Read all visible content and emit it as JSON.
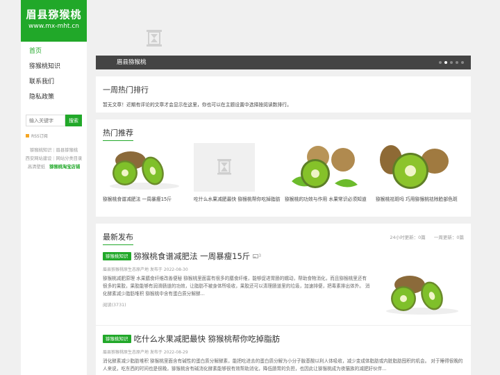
{
  "site": {
    "title": "眉县猕猴桃",
    "url": "www.mx-mht.cn"
  },
  "nav": [
    {
      "label": "首页",
      "active": true
    },
    {
      "label": "猕猴桃知识",
      "active": false
    },
    {
      "label": "联系我们",
      "active": false
    },
    {
      "label": "隐私政策",
      "active": false
    }
  ],
  "search": {
    "placeholder": "输入关键字",
    "button": "搜索"
  },
  "rss": "RSS订阅",
  "links": [
    "猕猴桃知识",
    "眉县猕猴桃",
    "西安网站建设",
    "网站分类目录",
    "高清壁纸",
    "猕猴桃淘宝店铺"
  ],
  "banner": {
    "caption": "眉县猕猴桃"
  },
  "hot_week": {
    "title": "一周热门排行",
    "note": "暂无文章！近期有评论的文章才会显示在这里，你也可以在主题设置中选择按阅读数排行。"
  },
  "recommend": {
    "title": "热门推荐",
    "items": [
      "猕猴桃食谱减肥法 一周暴瘦15斤",
      "吃什么水果减肥最快 猕猴桃帮你吃掉脂肪",
      "猕猴桃的功效与作用 水果常识必须知道",
      "猕猴桃祛斑吗 巧用猕猴桃祛除脸部色斑"
    ]
  },
  "latest": {
    "title": "最新发布",
    "stats": [
      "24小时更新：0篇",
      "一周更新：0篇"
    ],
    "posts": [
      {
        "tag": "猕猴桃知识",
        "title": "猕猴桃食谱减肥法 一周暴瘦15斤",
        "count": "3",
        "meta": "眉县猕猴桃原生态原产地 发布于 2022-08-30",
        "excerpt": "猕猴桃减肥原理 水果膳食纤维改善便秘 猕猴桃里面富有很多的膳食纤维，能够促进胃肠的蠕动，帮助食物消化，而且猕猴桃里还有很多的果胶，果胶能够有润滑肠道的功效，让脂肪不被身体所吸收，果胶还可以清理肠道里的垃圾，加速排便，把毒素排出体外。 消化酵素减少脂肪堆积 猕猴桃中含有蛋白质分解酵...",
        "reads": "阅读(3731)"
      },
      {
        "tag": "猕猴桃知识",
        "title": "吃什么水果减肥最快 猕猴桃帮你吃掉脂肪",
        "meta": "眉县猕猴桃原生态原产地 发布于 2022-08-29",
        "excerpt": "消化酵素减少脂肪堆积 猕猴桃里面含有碱性的蛋白质分解酵素，能把吃进去的蛋白质分解为小分子胺基酸以利人体吸收，减少变成体脂肪或内脏脂肪囤积的机会。 对于睡得很晚的人来说，吃东西的时间也是很晚，猕猴桃含有碱消化酵素能够很有效帮助消化，降低肠胃的负担，也因此让猕猴桃成为夜猫族的减肥好伙伴..."
      }
    ]
  },
  "colors": {
    "accent": "#21a829",
    "banner_bar": "#444444"
  }
}
